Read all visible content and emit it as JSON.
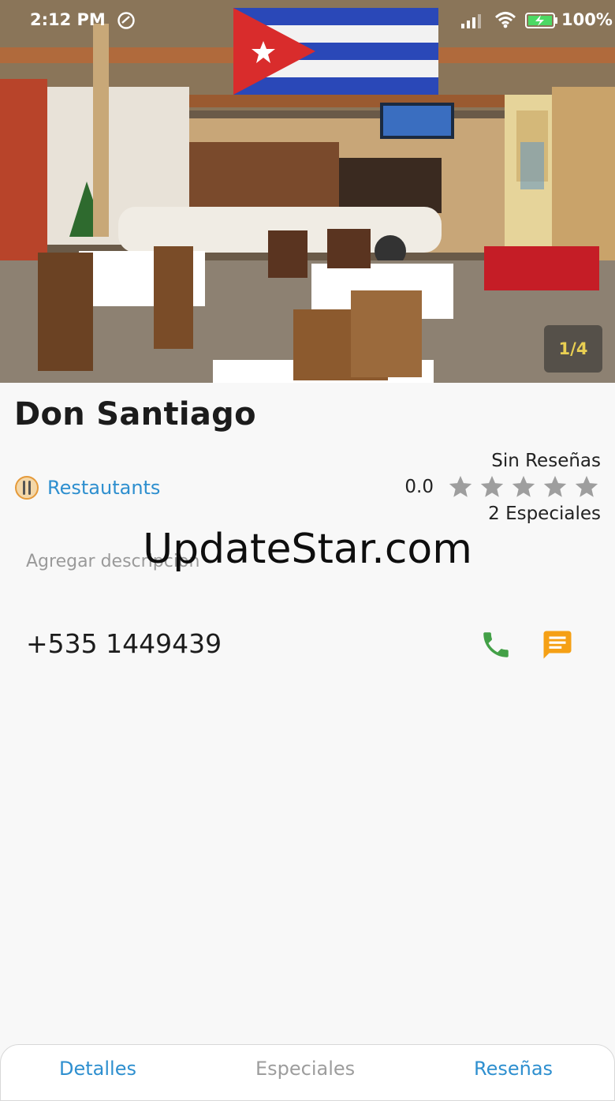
{
  "status_bar": {
    "time": "2:12 PM",
    "battery_text": "100%",
    "icons": [
      "do-not-disturb-icon",
      "signal-icon",
      "wifi-icon",
      "battery-charging-icon"
    ]
  },
  "gallery": {
    "page_indicator": "1/4",
    "current_index": 1,
    "total": 4
  },
  "restaurant": {
    "name": "Don Santiago",
    "category": "Restautants",
    "category_icon": "restaurant-icon",
    "reviews_label": "Sin Reseñas",
    "rating_value": "0.0",
    "rating_stars": 0,
    "max_stars": 5,
    "specials_label": "2 Especiales",
    "description_placeholder": "Agregar descripcion",
    "phone": "+535 1449439"
  },
  "actions": {
    "call_icon": "phone-icon",
    "message_icon": "message-icon"
  },
  "watermark": "UpdateStar.com",
  "tabs": [
    {
      "label": "Detalles",
      "active": true
    },
    {
      "label": "Especiales",
      "active": false
    },
    {
      "label": "Reseñas",
      "active": true
    }
  ],
  "colors": {
    "accent_blue": "#2e8fcf",
    "call_green": "#43a047",
    "message_orange": "#f5a015",
    "star_gray": "#9e9e9e",
    "indicator_yellow": "#e9cf52"
  }
}
